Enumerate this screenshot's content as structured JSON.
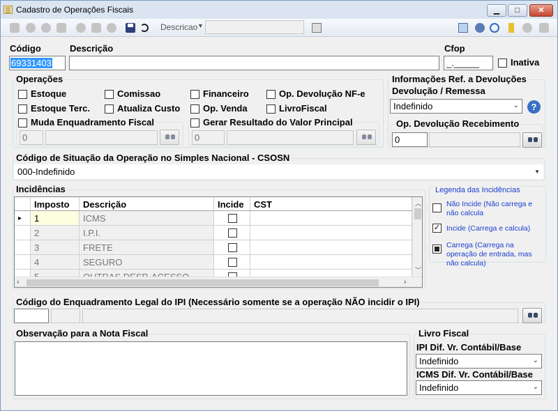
{
  "window": {
    "title": "Cadastro de Operações Fiscais",
    "min_label": "▁",
    "max_label": "□",
    "close_label": "✕"
  },
  "toolbar": {
    "search_field_label": "Descricao",
    "search_value": ""
  },
  "fields": {
    "codigo_label": "Código",
    "codigo_value": "69331403",
    "descricao_label": "Descrição",
    "descricao_value": "",
    "cfop_label": "Cfop",
    "cfop_value": "_._____",
    "inativa_label": "Inativa"
  },
  "operacoes": {
    "title": "Operações",
    "estoque": "Estoque",
    "comissao": "Comissao",
    "financeiro": "Financeiro",
    "op_devolucao_nfe": "Op.  Devolução NF-e",
    "estoque_terc": "Estoque Terc.",
    "atualiza_custo": "Atualiza Custo",
    "op_venda": "Op. Venda",
    "livro_fiscal": "LivroFiscal",
    "muda_enquadramento": "Muda Enquadramento Fiscal",
    "muda_value": "0",
    "gerar_resultado": "Gerar Resultado do Valor Principal",
    "gerar_value": "0"
  },
  "devolucoes": {
    "title_line1": "Informações Ref. a Devoluções",
    "title_line2": "Devolução / Remessa",
    "selected": "Indefinido",
    "help": "?",
    "op_dev_receb_label": "Op. Devolução Recebimento",
    "op_dev_receb_value": "0"
  },
  "csosn": {
    "label": "Código de Situação da Operação no Simples Nacional - CSOSN",
    "selected": "000-Indefinido"
  },
  "incidencias": {
    "title": "Incidências",
    "columns": {
      "imposto": "Imposto",
      "descricao": "Descrição",
      "incide": "Incide",
      "cst": "CST"
    },
    "rows": [
      {
        "imposto": "1",
        "descricao": "ICMS"
      },
      {
        "imposto": "2",
        "descricao": "I.P.I."
      },
      {
        "imposto": "3",
        "descricao": "FRETE"
      },
      {
        "imposto": "4",
        "descricao": "SEGURO"
      },
      {
        "imposto": "5",
        "descricao": "OUTRAS DESP. ACESSO"
      }
    ],
    "row_marker": "▸"
  },
  "legenda": {
    "title": "Legenda das Incidências",
    "nao_incide": "Não Incide (Não carrega e não calcula",
    "incide": "Incide (Carrega e calcula)",
    "carrega": "Carrega (Carrega na operação de entrada, mas não calcula)"
  },
  "ipi": {
    "label": "Código do Enquadramento Legal do IPI (Necessário somente se a operação NÃO incidir o IPI)",
    "code_value": "",
    "desc_value": ""
  },
  "observacao": {
    "label": "Observação para a Nota Fiscal",
    "value": ""
  },
  "livro_fiscal": {
    "title": "Livro Fiscal",
    "ipi_label": "IPI Dif. Vr. Contábil/Base",
    "ipi_selected": "Indefinido",
    "icms_label": "ICMS Dif. Vr. Contábil/Base",
    "icms_selected": "Indefinido"
  },
  "colors": {
    "accent_blue": "#1a3fcf",
    "selection": "#3399ff",
    "help_blue": "#3a6fc4"
  }
}
